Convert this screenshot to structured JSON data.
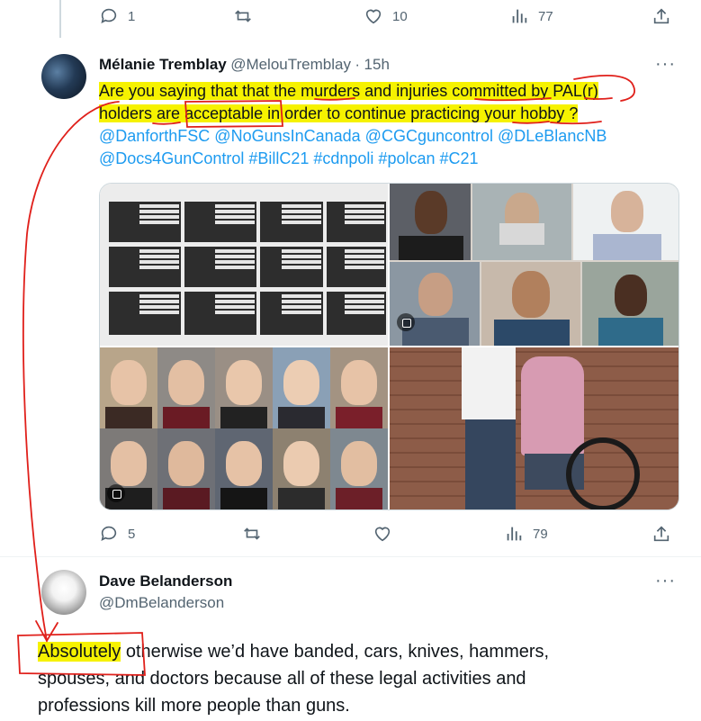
{
  "top_actions": {
    "reply_count": "1",
    "like_count": "10",
    "view_count": "77"
  },
  "tweet": {
    "author_name": "Mélanie Tremblay",
    "handle": "@MelouTremblay",
    "dot": "·",
    "time": "15h",
    "more": "···",
    "text_line1": "Are you saying that that the murders and injuries committed by PAL(r)",
    "text_line2_a": "holders are ",
    "text_line2_b": "acceptable",
    "text_line2_c": " in order to continue practicing your hobby ?",
    "links_line1": "@DanforthFSC @NoGunsInCanada @CGCguncontrol @DLeBlancNB",
    "links_line2": "@Docs4GunControl #BillC21 #cdnpoli #polcan #C21",
    "reply_count": "5",
    "view_count": "79"
  },
  "reply": {
    "author_name": "Dave Belanderson",
    "handle": "@DmBelanderson",
    "more": "···",
    "line1_a": "Absolutely",
    "line1_b": " otherwise we’d have banded, cars, knives, hammers,",
    "line2": "spouses, and doctors because all of these legal activities and",
    "line3": "professions kill more people than guns."
  },
  "colors": {
    "highlight": "#f6f200",
    "annotation": "#e0201b",
    "link": "#1d9bf0",
    "muted": "#536471"
  }
}
